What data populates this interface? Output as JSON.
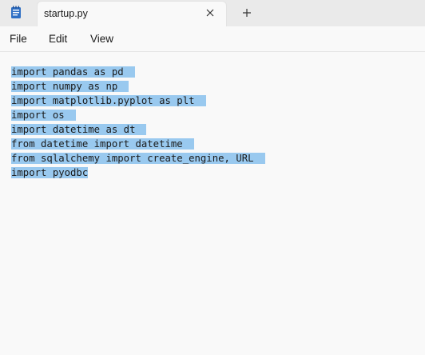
{
  "tab": {
    "title": "startup.py"
  },
  "menu": [
    "File",
    "Edit",
    "View"
  ],
  "editor": {
    "lines": [
      "import pandas as pd",
      "import numpy as np",
      "import matplotlib.pyplot as plt",
      "import os",
      "import datetime as dt",
      "from datetime import datetime",
      "from sqlalchemy import create_engine, URL",
      "import pyodbc"
    ],
    "selection_color": "#99c9ef"
  },
  "icons": {
    "app": "notepad-icon",
    "close": "close-icon",
    "new_tab": "plus-icon"
  }
}
